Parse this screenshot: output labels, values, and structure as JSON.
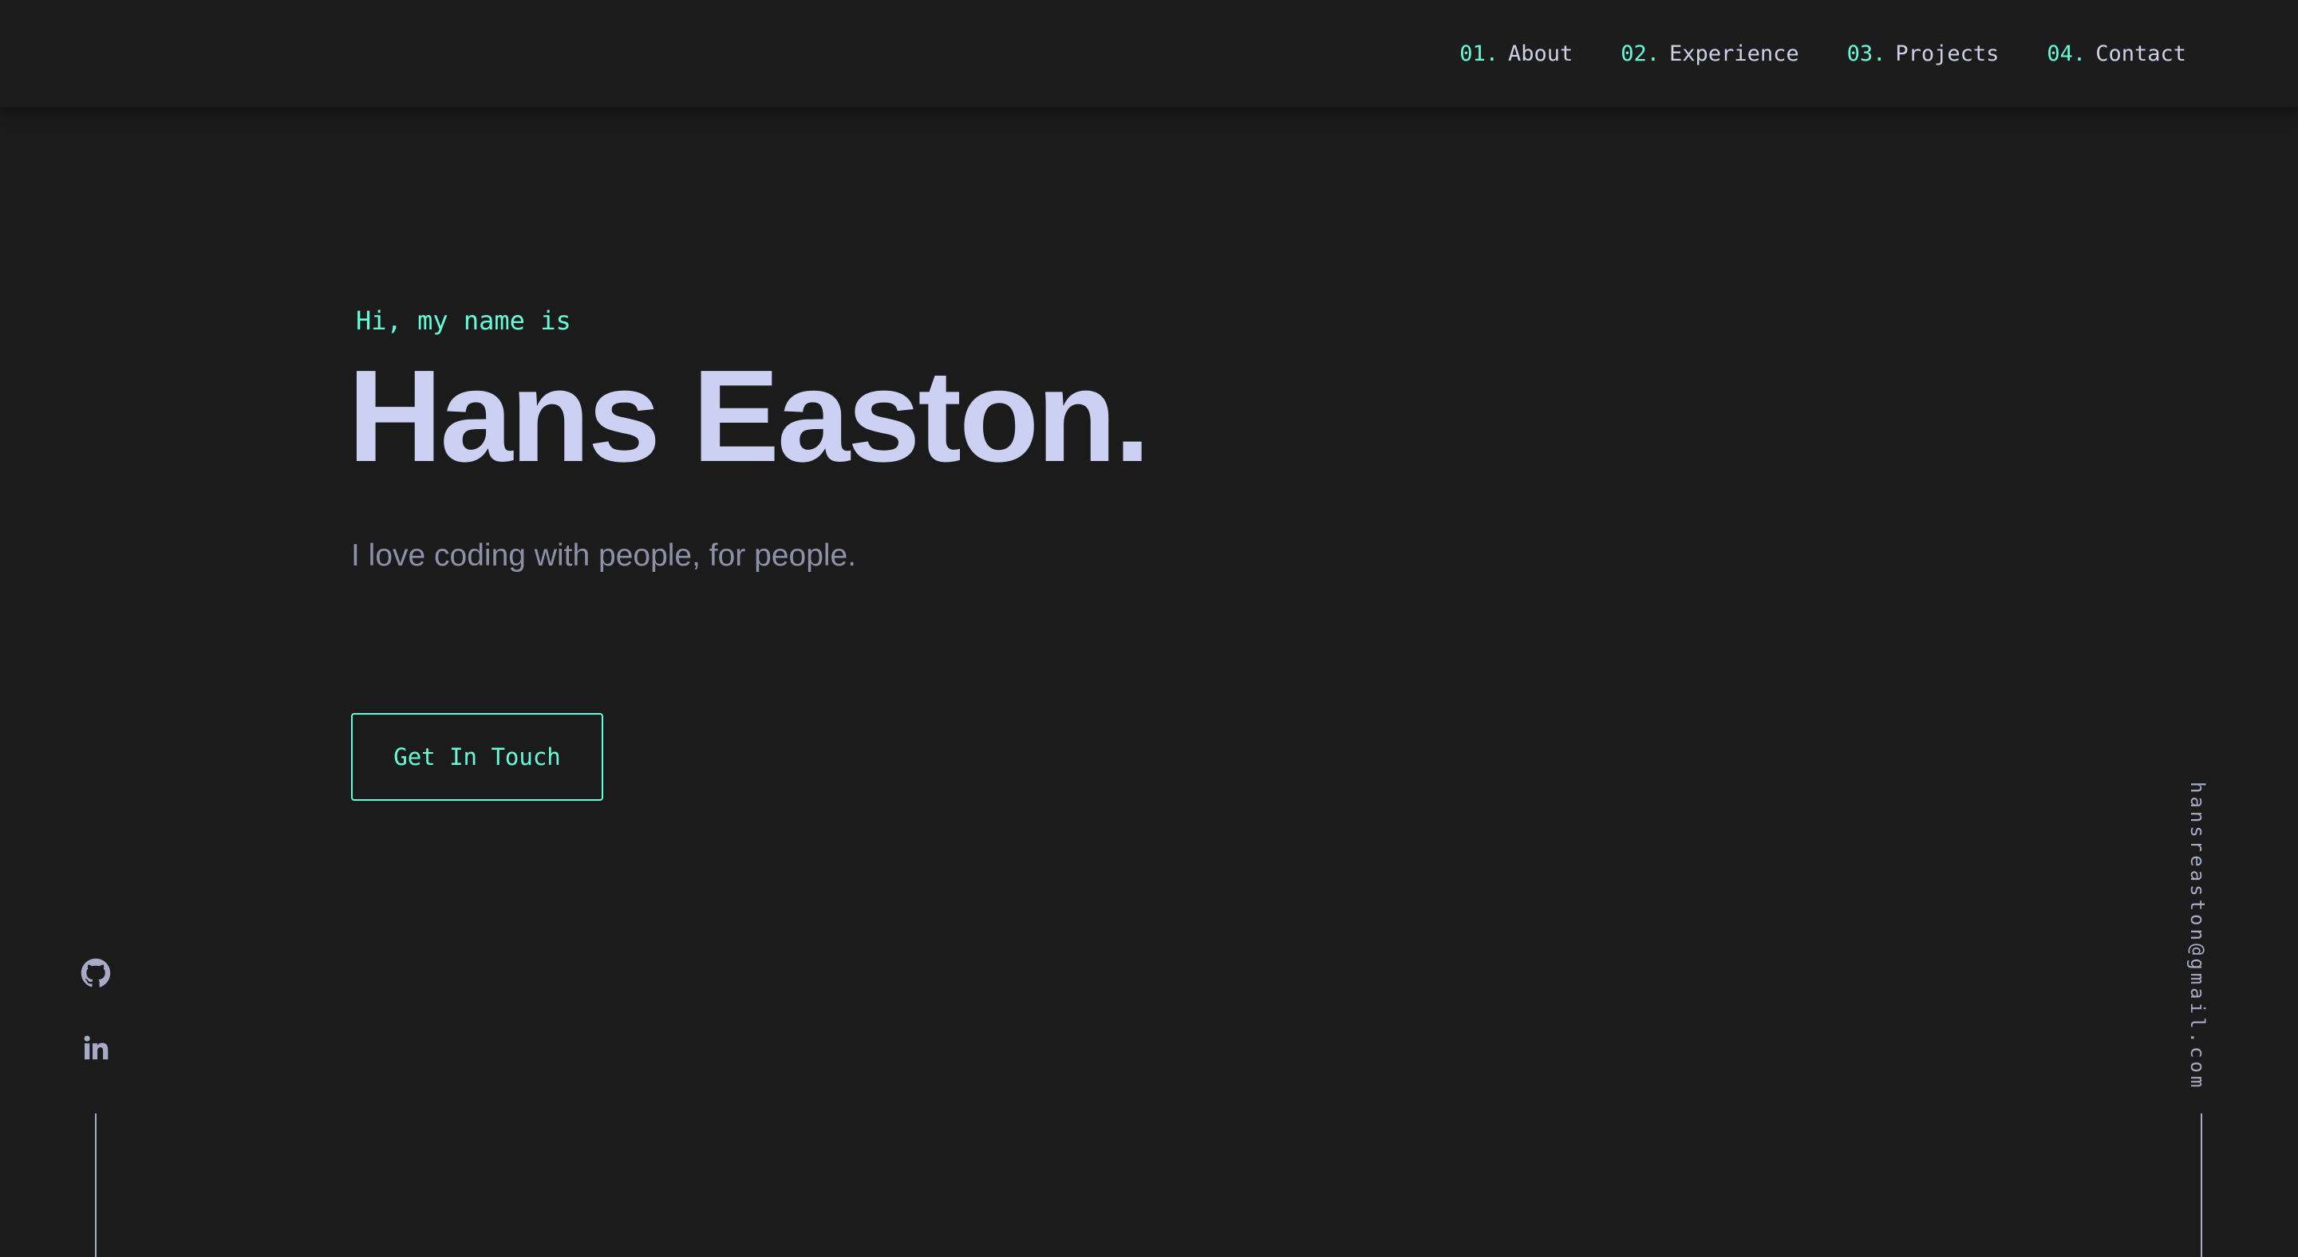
{
  "nav": {
    "items": [
      {
        "num": "01.",
        "label": "About"
      },
      {
        "num": "02.",
        "label": "Experience"
      },
      {
        "num": "03.",
        "label": "Projects"
      },
      {
        "num": "04.",
        "label": "Contact"
      }
    ]
  },
  "hero": {
    "greeting": "Hi, my name is",
    "name": "Hans Easton.",
    "tagline": "I love coding with people, for people.",
    "cta_label": "Get In Touch"
  },
  "social": {
    "links": [
      {
        "icon": "github-icon"
      },
      {
        "icon": "linkedin-icon"
      }
    ]
  },
  "email": "hansreaston@gmail.com",
  "colors": {
    "background": "#1b1b1b",
    "accent": "#64ffda",
    "heading": "#ccd0f3",
    "muted": "#8d90a8",
    "nav_text": "#cdd0e6",
    "icon": "#a8abc8"
  }
}
